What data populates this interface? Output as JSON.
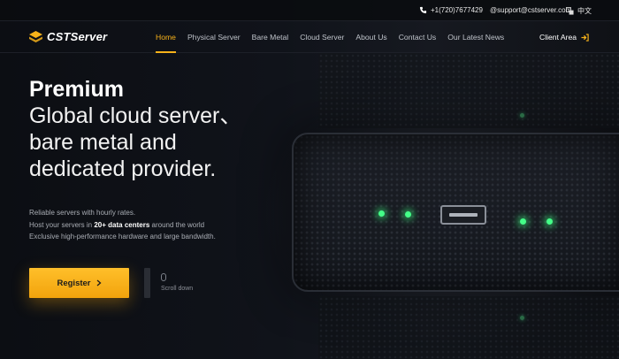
{
  "topbar": {
    "phone": "+1(720)7677429",
    "email": "@support@cstserver.com",
    "language": "中文"
  },
  "nav": {
    "logo_text": "CSTServer",
    "menu": [
      {
        "label": "Home",
        "active": true
      },
      {
        "label": "Physical Server",
        "active": false
      },
      {
        "label": "Bare Metal",
        "active": false
      },
      {
        "label": "Cloud Server",
        "active": false
      },
      {
        "label": "About Us",
        "active": false
      },
      {
        "label": "Contact Us",
        "active": false
      },
      {
        "label": "Our Latest News",
        "active": false
      }
    ],
    "client_area": "Client Area"
  },
  "hero": {
    "title_strong": "Premium",
    "title_lines": [
      "Global cloud server、",
      "bare metal and",
      "dedicated provider."
    ],
    "desc_line1": "Reliable servers with hourly rates.",
    "desc_line2_pre": "Host your servers in ",
    "desc_line2_bold": "20+ data centers",
    "desc_line2_post": " around the world",
    "desc_line3": "Exclusive high-performance hardware and large bandwidth.",
    "register_label": "Register",
    "scroll_label": "Scroll down"
  },
  "colors": {
    "accent": "#f7b21a",
    "background": "#0d0f14",
    "led": "#44ff88"
  },
  "icons": {
    "phone": "phone-icon",
    "email": "email-icon",
    "language": "translate-icon",
    "logo": "logo-icon",
    "client": "login-icon",
    "register": "chevron-right-icon",
    "scroll": "mouse-icon"
  }
}
